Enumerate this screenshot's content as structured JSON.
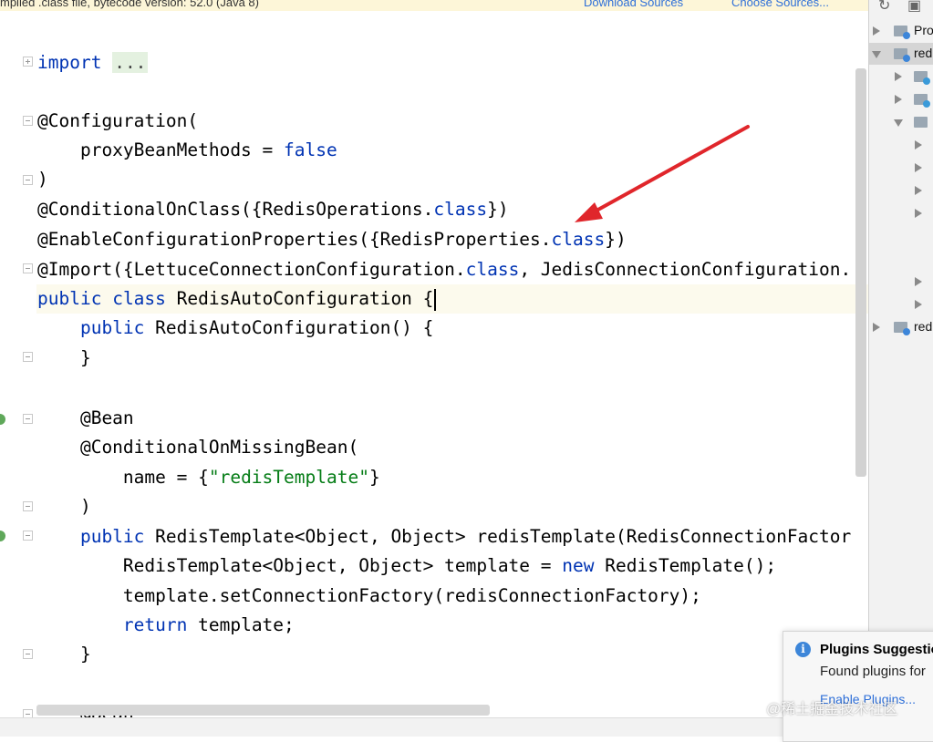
{
  "banner": {
    "message": "mpiled .class file, bytecode version: 52.0 (Java 8)",
    "download_sources": "Download Sources",
    "choose_sources": "Choose Sources..."
  },
  "code": {
    "lines": [
      {
        "parts": [
          {
            "t": "import",
            "c": "kw"
          },
          {
            "t": " "
          },
          {
            "t": "...",
            "c": "folded"
          }
        ]
      },
      {
        "parts": [
          {
            "t": "@Configuration("
          }
        ]
      },
      {
        "parts": [
          {
            "t": "    proxyBeanMethods = "
          },
          {
            "t": "false",
            "c": "kw"
          }
        ]
      },
      {
        "parts": [
          {
            "t": ")"
          }
        ]
      },
      {
        "parts": [
          {
            "t": "@ConditionalOnClass({RedisOperations."
          },
          {
            "t": "class",
            "c": "kw"
          },
          {
            "t": "})"
          }
        ]
      },
      {
        "parts": [
          {
            "t": "@EnableConfigurationProperties({RedisProperties."
          },
          {
            "t": "class",
            "c": "kw"
          },
          {
            "t": "})"
          }
        ]
      },
      {
        "parts": [
          {
            "t": "@Import({LettuceConnectionConfiguration."
          },
          {
            "t": "class",
            "c": "kw"
          },
          {
            "t": ", JedisConnectionConfiguration."
          }
        ]
      },
      {
        "parts": [
          {
            "t": "public",
            "c": "kw"
          },
          {
            "t": " "
          },
          {
            "t": "class",
            "c": "kw"
          },
          {
            "t": " RedisAutoConfiguration {"
          }
        ],
        "caret": true
      },
      {
        "parts": [
          {
            "t": "    "
          },
          {
            "t": "public",
            "c": "kw"
          },
          {
            "t": " RedisAutoConfiguration() {"
          }
        ]
      },
      {
        "parts": [
          {
            "t": "    }"
          }
        ]
      },
      {
        "parts": [
          {
            "t": ""
          }
        ]
      },
      {
        "parts": [
          {
            "t": "    @Bean"
          }
        ]
      },
      {
        "parts": [
          {
            "t": "    @ConditionalOnMissingBean("
          }
        ]
      },
      {
        "parts": [
          {
            "t": "        name = {"
          },
          {
            "t": "\"redisTemplate\"",
            "c": "str"
          },
          {
            "t": "}"
          }
        ]
      },
      {
        "parts": [
          {
            "t": "    )"
          }
        ]
      },
      {
        "parts": [
          {
            "t": "    "
          },
          {
            "t": "public",
            "c": "kw"
          },
          {
            "t": " RedisTemplate<Object, Object> redisTemplate(RedisConnectionFactor"
          }
        ]
      },
      {
        "parts": [
          {
            "t": "        RedisTemplate<Object, Object> template = "
          },
          {
            "t": "new",
            "c": "kw"
          },
          {
            "t": " RedisTemplate();"
          }
        ]
      },
      {
        "parts": [
          {
            "t": "        template.setConnectionFactory(redisConnectionFactory);"
          }
        ]
      },
      {
        "parts": [
          {
            "t": "        "
          },
          {
            "t": "return",
            "c": "kw"
          },
          {
            "t": " template;"
          }
        ]
      },
      {
        "parts": [
          {
            "t": "    }"
          }
        ]
      },
      {
        "parts": [
          {
            "t": ""
          }
        ]
      },
      {
        "parts": [
          {
            "t": "    @Bean"
          }
        ]
      }
    ]
  },
  "project_tree": {
    "items": [
      {
        "label": "Pro"
      },
      {
        "label": "red"
      },
      {
        "label": "red"
      }
    ]
  },
  "notification": {
    "title": "Plugins Suggestion",
    "body": "Found plugins for",
    "link": "Enable Plugins..."
  },
  "watermark": "@稀土掘金技术社区",
  "icons": {
    "fold": "fold-marker-icon",
    "info": "info-icon",
    "arrow": "red-arrow-annotation"
  },
  "colors": {
    "keyword": "#0033b3",
    "string": "#067d17",
    "arrow": "#e0262b"
  }
}
